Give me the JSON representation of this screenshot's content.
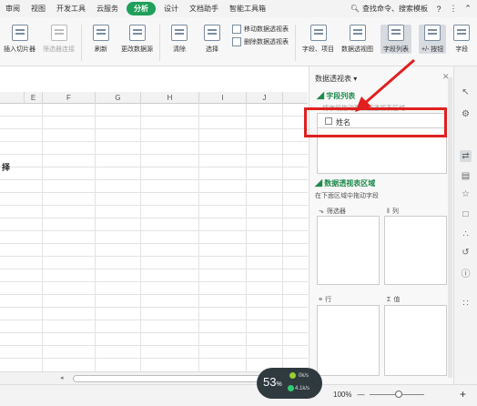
{
  "menu": {
    "tabs": [
      "审阅",
      "视图",
      "开发工具",
      "云服务",
      "分析",
      "设计",
      "文档助手",
      "智能工具箱"
    ],
    "active_tab": "分析",
    "search_label": "查找命令、搜索模板",
    "search_icon": "search-icon",
    "help_icon": "question-icon",
    "more_icon": "more-icon",
    "collapse_icon": "chevron-up-icon"
  },
  "toolbar": {
    "insert_slicer": "插入切片器",
    "filter_connect": "筛选器连接",
    "refresh": "刷新",
    "change_source": "更改数据源",
    "clear": "清除",
    "select": "选择",
    "move_pivot": "移动数据透视表",
    "delete_pivot": "删除数据透视表",
    "field_items": "字段、项目",
    "pivot_chart": "数据透视图",
    "field_list": "字段列表",
    "plus_minus": "+/- 按钮",
    "field_headers": "字段"
  },
  "grid": {
    "columns": [
      "E",
      "F",
      "G",
      "H",
      "I",
      "J"
    ],
    "side_char": "择"
  },
  "panel": {
    "title": "数据透视表",
    "title_caret": "▾",
    "field_list_header": "字段列表",
    "field_list_hint": "将字段拖动至数据透视表区域",
    "fields": [
      {
        "name": "姓名",
        "checked": false
      }
    ],
    "areas_header": "数据透视表区域",
    "areas_hint": "在下面区域中拖动字段",
    "filter_label": "筛选器",
    "column_label": "列",
    "row_label": "行",
    "value_label": "值"
  },
  "status": {
    "zoom": "100%",
    "zoom_minus": "—",
    "zoom_plus": "+"
  },
  "speed_widget": {
    "percent": "53",
    "percent_unit": "%",
    "upload": "0k/s",
    "download": "4.1k/s"
  },
  "accent_colors": {
    "active_tab": "#1fa05a",
    "section": "#1f8a4c",
    "highlight": "#e02020"
  }
}
